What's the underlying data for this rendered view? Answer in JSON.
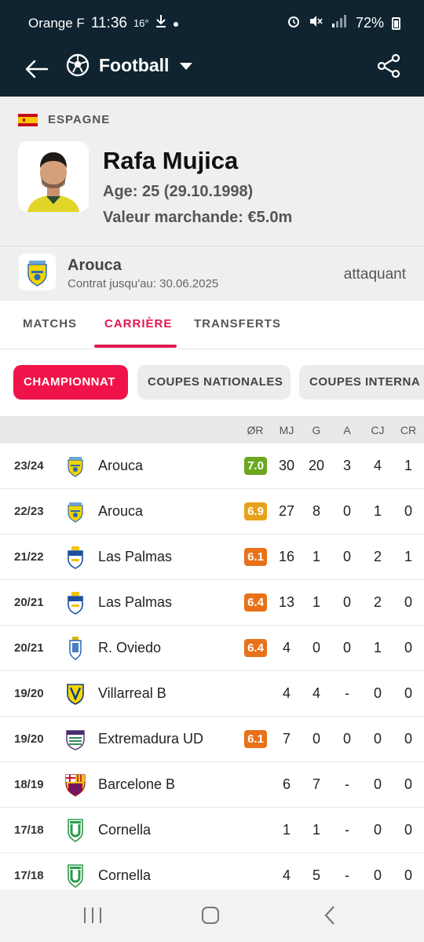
{
  "status_bar": {
    "carrier": "Orange F",
    "time": "11:36",
    "temperature": "16°",
    "battery": "72%"
  },
  "app_bar": {
    "title": "Football"
  },
  "player": {
    "country": "ESPAGNE",
    "name": "Rafa Mujica",
    "age_line": "Age: 25 (29.10.1998)",
    "value_line": "Valeur marchande: €5.0m"
  },
  "team": {
    "name": "Arouca",
    "contract": "Contrat jusqu'au: 30.06.2025",
    "position": "attaquant"
  },
  "tabs": [
    {
      "label": "MATCHS"
    },
    {
      "label": "CARRIÈRE"
    },
    {
      "label": "TRANSFERTS"
    }
  ],
  "chips": [
    {
      "label": "CHAMPIONNAT"
    },
    {
      "label": "COUPES NATIONALES"
    },
    {
      "label": "COUPES INTERNA"
    }
  ],
  "table": {
    "headers": {
      "rating": "ØR",
      "mj": "MJ",
      "g": "G",
      "a": "A",
      "cj": "CJ",
      "cr": "CR"
    },
    "rows": [
      {
        "season": "23/24",
        "club": "Arouca",
        "logo": "arouca-logo",
        "rating": "7.0",
        "rating_color": "#6aa820",
        "mj": "30",
        "g": "20",
        "a": "3",
        "cj": "4",
        "cr": "1"
      },
      {
        "season": "22/23",
        "club": "Arouca",
        "logo": "arouca-logo",
        "rating": "6.9",
        "rating_color": "#e8a21a",
        "mj": "27",
        "g": "8",
        "a": "0",
        "cj": "1",
        "cr": "0"
      },
      {
        "season": "21/22",
        "club": "Las Palmas",
        "logo": "las-palmas-logo",
        "rating": "6.1",
        "rating_color": "#e8711a",
        "mj": "16",
        "g": "1",
        "a": "0",
        "cj": "2",
        "cr": "1"
      },
      {
        "season": "20/21",
        "club": "Las Palmas",
        "logo": "las-palmas-logo",
        "rating": "6.4",
        "rating_color": "#e8711a",
        "mj": "13",
        "g": "1",
        "a": "0",
        "cj": "2",
        "cr": "0"
      },
      {
        "season": "20/21",
        "club": "R. Oviedo",
        "logo": "oviedo-logo",
        "rating": "6.4",
        "rating_color": "#e8711a",
        "mj": "4",
        "g": "0",
        "a": "0",
        "cj": "1",
        "cr": "0"
      },
      {
        "season": "19/20",
        "club": "Villarreal B",
        "logo": "villarreal-logo",
        "rating": "",
        "rating_color": "",
        "mj": "4",
        "g": "4",
        "a": "-",
        "cj": "0",
        "cr": "0"
      },
      {
        "season": "19/20",
        "club": "Extremadura UD",
        "logo": "extremadura-logo",
        "rating": "6.1",
        "rating_color": "#e8711a",
        "mj": "7",
        "g": "0",
        "a": "0",
        "cj": "0",
        "cr": "0"
      },
      {
        "season": "18/19",
        "club": "Barcelone B",
        "logo": "barcelona-logo",
        "rating": "",
        "rating_color": "",
        "mj": "6",
        "g": "7",
        "a": "-",
        "cj": "0",
        "cr": "0"
      },
      {
        "season": "17/18",
        "club": "Cornella",
        "logo": "cornella-logo",
        "rating": "",
        "rating_color": "",
        "mj": "1",
        "g": "1",
        "a": "-",
        "cj": "0",
        "cr": "0"
      },
      {
        "season": "17/18",
        "club": "Cornella",
        "logo": "cornella-logo",
        "rating": "",
        "rating_color": "",
        "mj": "4",
        "g": "5",
        "a": "-",
        "cj": "0",
        "cr": "0"
      }
    ]
  },
  "colors": {
    "header_bg": "#0f2430",
    "accent": "#e1174f",
    "chip_active": "#f0134a"
  }
}
